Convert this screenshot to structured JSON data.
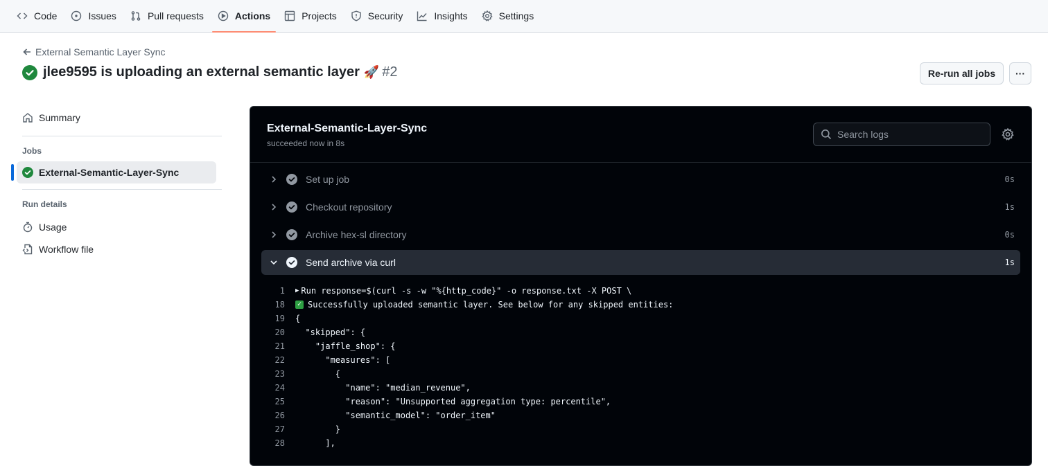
{
  "repo_nav": {
    "tabs": [
      {
        "label": "Code",
        "icon": "code-icon"
      },
      {
        "label": "Issues",
        "icon": "issue-icon"
      },
      {
        "label": "Pull requests",
        "icon": "pull-request-icon"
      },
      {
        "label": "Actions",
        "icon": "play-icon",
        "active": true
      },
      {
        "label": "Projects",
        "icon": "table-icon"
      },
      {
        "label": "Security",
        "icon": "shield-icon"
      },
      {
        "label": "Insights",
        "icon": "graph-icon"
      },
      {
        "label": "Settings",
        "icon": "gear-icon"
      }
    ]
  },
  "header": {
    "back_label": "External Semantic Layer Sync",
    "title": "jlee9595 is uploading an external semantic layer",
    "title_emoji": "🚀",
    "run_number": "#2",
    "rerun_label": "Re-run all jobs",
    "more_label": "···"
  },
  "sidebar": {
    "summary_label": "Summary",
    "jobs_heading": "Jobs",
    "job_label": "External-Semantic-Layer-Sync",
    "run_details_heading": "Run details",
    "usage_label": "Usage",
    "workflow_file_label": "Workflow file"
  },
  "job": {
    "title": "External-Semantic-Layer-Sync",
    "subtitle": "succeeded now in 8s",
    "search_placeholder": "Search logs",
    "steps": [
      {
        "name": "Set up job",
        "duration": "0s",
        "expanded": false
      },
      {
        "name": "Checkout repository",
        "duration": "1s",
        "expanded": false
      },
      {
        "name": "Archive hex-sl directory",
        "duration": "0s",
        "expanded": false
      },
      {
        "name": "Send archive via curl",
        "duration": "1s",
        "expanded": true
      }
    ],
    "log_lines": [
      {
        "no": "1",
        "text": "Run response=$(curl -s -w \"%{http_code}\" -o response.txt -X POST \\",
        "prefix": "triangle"
      },
      {
        "no": "18",
        "text": "Successfully uploaded semantic layer. See below for any skipped entities:",
        "prefix": "check"
      },
      {
        "no": "19",
        "text": "{"
      },
      {
        "no": "20",
        "text": "  \"skipped\": {"
      },
      {
        "no": "21",
        "text": "    \"jaffle_shop\": {"
      },
      {
        "no": "22",
        "text": "      \"measures\": ["
      },
      {
        "no": "23",
        "text": "        {"
      },
      {
        "no": "24",
        "text": "          \"name\": \"median_revenue\","
      },
      {
        "no": "25",
        "text": "          \"reason\": \"Unsupported aggregation type: percentile\","
      },
      {
        "no": "26",
        "text": "          \"semantic_model\": \"order_item\""
      },
      {
        "no": "27",
        "text": "        }"
      },
      {
        "no": "28",
        "text": "      ],"
      }
    ]
  },
  "colors": {
    "success": "#1f883d",
    "accent": "#fd8c73",
    "selected_bar": "#0969da",
    "log_bg": "#010409"
  }
}
